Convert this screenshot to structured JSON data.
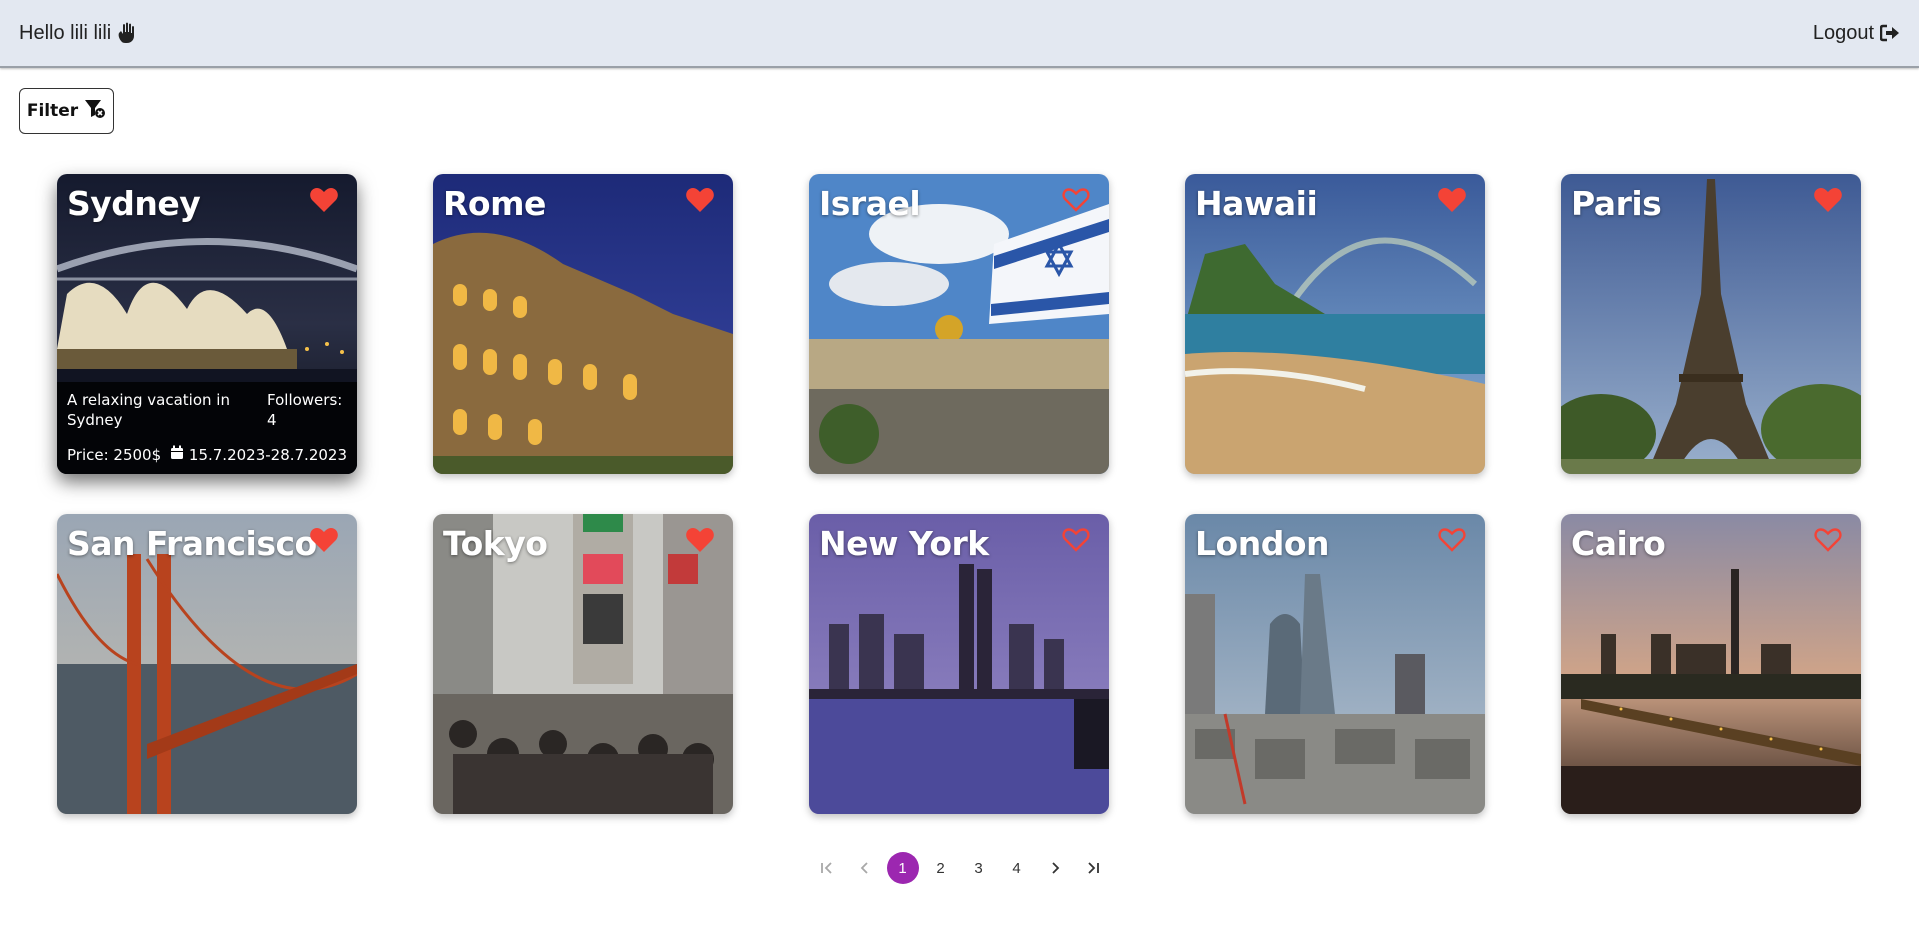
{
  "header": {
    "greeting": "Hello lili lili",
    "logout_label": "Logout"
  },
  "toolbar": {
    "filter_label": "Filter"
  },
  "vacations": [
    {
      "name": "Sydney",
      "liked": true,
      "description": "A relaxing vacation in Sydney",
      "followers_label": "Followers:",
      "followers": "4",
      "price": "Price: 2500$",
      "dates": "15.7.2023-28.7.2023"
    },
    {
      "name": "Rome",
      "liked": true
    },
    {
      "name": "Israel",
      "liked": false
    },
    {
      "name": "Hawaii",
      "liked": true
    },
    {
      "name": "Paris",
      "liked": true
    },
    {
      "name": "San Francisco",
      "liked": true
    },
    {
      "name": "Tokyo",
      "liked": true
    },
    {
      "name": "New York",
      "liked": false
    },
    {
      "name": "London",
      "liked": false
    },
    {
      "name": "Cairo",
      "liked": false
    }
  ],
  "pagination": {
    "pages": [
      "1",
      "2",
      "3",
      "4"
    ],
    "current": "1"
  },
  "colors": {
    "heart": "#f44336",
    "accent": "#9c27b0",
    "header_bg": "#e3e8f1"
  }
}
